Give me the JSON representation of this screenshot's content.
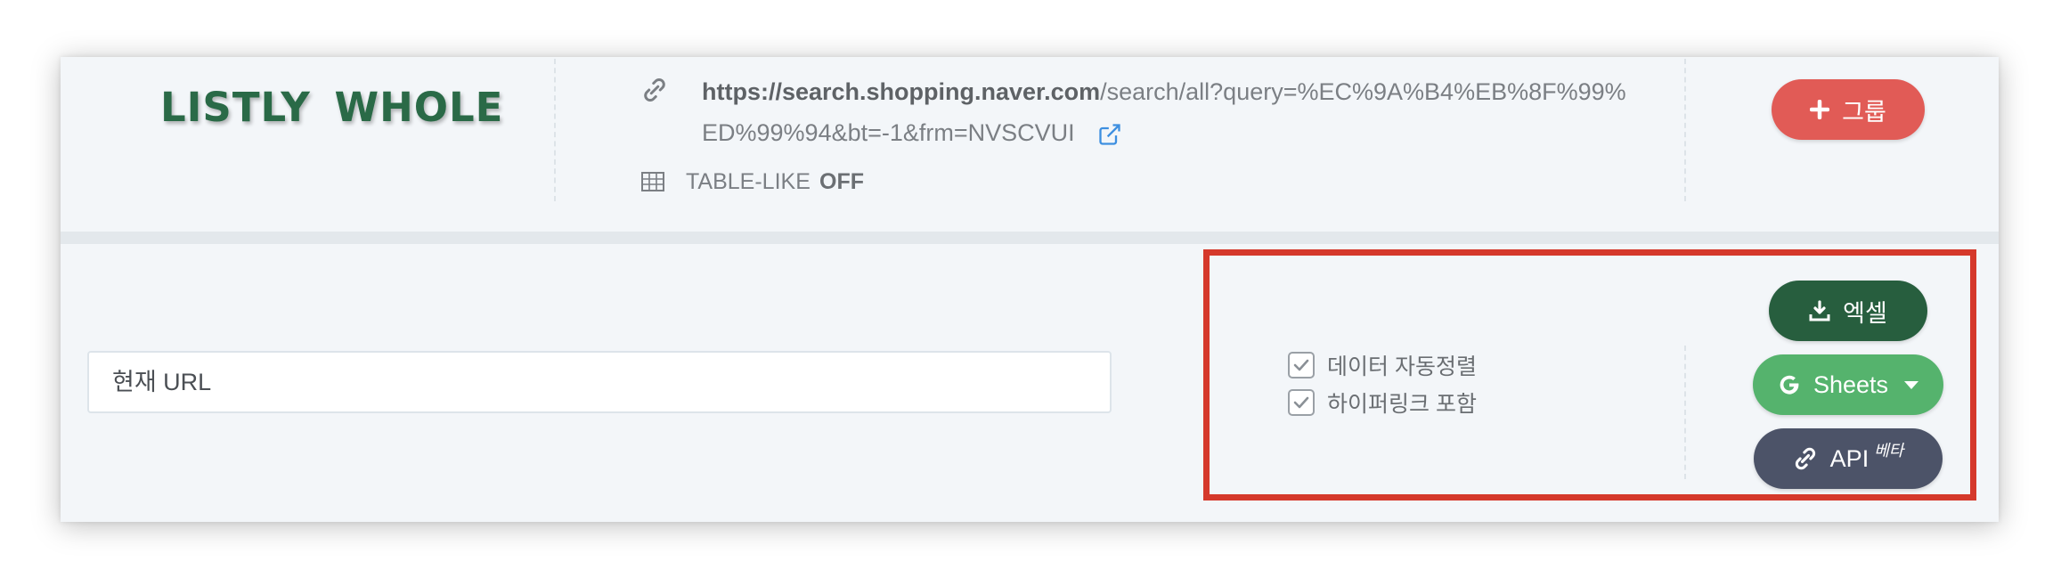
{
  "header": {
    "logo_text": "LISTLY  WHOLE",
    "url": {
      "domain": "https://search.shopping.naver.com",
      "path_line1": "/search/all?query=%EC%9A%B4%EB%8F%99%",
      "path_line2": "ED%99%94&bt=-1&frm=NVSCVUI"
    },
    "table_like": {
      "label": "TABLE-LIKE",
      "value": "OFF"
    },
    "group_button_label": "그룹"
  },
  "main": {
    "url_input_placeholder": "현재 URL",
    "options": [
      {
        "label": "데이터 자동정렬",
        "checked": true
      },
      {
        "label": "하이퍼링크 포함",
        "checked": true
      }
    ],
    "buttons": {
      "excel_label": "엑셀",
      "sheets_label": "Sheets",
      "api_label": "API",
      "api_badge": "베타"
    }
  },
  "colors": {
    "logo": "#2a6a47",
    "group_button": "#e15b56",
    "excel_button": "#275e3e",
    "sheets_button": "#55b36d",
    "api_button": "#4c5368",
    "highlight_border": "#d5392b"
  },
  "icons": [
    "link-icon",
    "external-link-icon",
    "table-icon",
    "plus-icon",
    "download-icon",
    "google-icon",
    "caret-down-icon",
    "chain-icon",
    "check-icon"
  ]
}
